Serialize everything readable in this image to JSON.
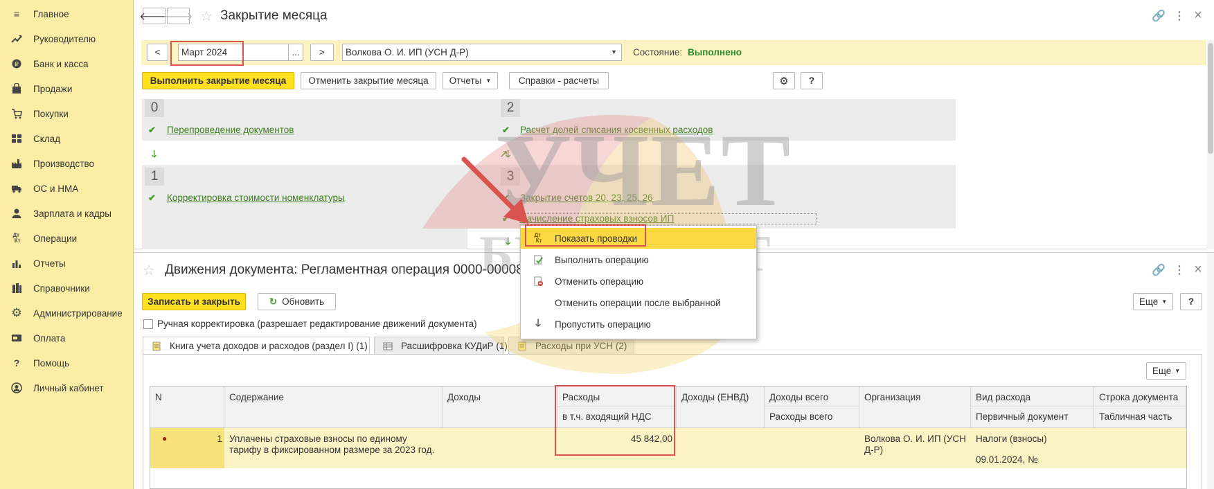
{
  "sidebar": {
    "items": [
      {
        "label": "Главное",
        "icon": "menu-icon"
      },
      {
        "label": "Руководителю",
        "icon": "trend-icon"
      },
      {
        "label": "Банк и касса",
        "icon": "coin-icon"
      },
      {
        "label": "Продажи",
        "icon": "bag-icon"
      },
      {
        "label": "Покупки",
        "icon": "cart-icon"
      },
      {
        "label": "Склад",
        "icon": "warehouse-icon"
      },
      {
        "label": "Производство",
        "icon": "factory-icon"
      },
      {
        "label": "ОС и НМА",
        "icon": "truck-icon"
      },
      {
        "label": "Зарплата и кадры",
        "icon": "person-icon"
      },
      {
        "label": "Операции",
        "icon": "dt-kt-icon"
      },
      {
        "label": "Отчеты",
        "icon": "bar-chart-icon"
      },
      {
        "label": "Справочники",
        "icon": "books-icon"
      },
      {
        "label": "Администрирование",
        "icon": "gear-icon"
      },
      {
        "label": "Оплата",
        "icon": "payment-icon"
      },
      {
        "label": "Помощь",
        "icon": "question-icon"
      },
      {
        "label": "Личный кабинет",
        "icon": "account-icon"
      }
    ]
  },
  "top_window": {
    "title": "Закрытие месяца",
    "period": "Март 2024",
    "period_select": "...",
    "prev": "<",
    "next": ">",
    "organization": "Волкова О. И. ИП (УСН Д-Р)",
    "state_label": "Состояние:",
    "state_value": "Выполнено",
    "buttons": {
      "run": "Выполнить закрытие месяца",
      "cancel": "Отменить закрытие месяца",
      "reports": "Отчеты",
      "refs": "Справки - расчеты",
      "help": "?"
    },
    "steps": [
      {
        "num": "0",
        "ops": [
          "Перепроведение документов"
        ]
      },
      {
        "num": "1",
        "ops": [
          "Корректировка стоимости номенклатуры"
        ]
      },
      {
        "num": "2",
        "ops": [
          "Расчет долей списания косвенных расходов"
        ]
      },
      {
        "num": "3",
        "ops": [
          "Закрытие счетов 20, 23, 25, 26",
          "Начисление страховых взносов ИП"
        ]
      }
    ]
  },
  "context_menu": {
    "items": [
      {
        "label": "Показать проводки",
        "icon": "dt-kt-icon",
        "selected": true
      },
      {
        "label": "Выполнить операцию",
        "icon": "run-op-icon",
        "selected": false
      },
      {
        "label": "Отменить операцию",
        "icon": "cancel-op-icon",
        "selected": false
      },
      {
        "label": "Отменить операции после выбранной",
        "icon": "",
        "selected": false
      },
      {
        "label": "Пропустить операцию",
        "icon": "arrow-down-icon",
        "selected": false
      }
    ]
  },
  "bottom_window": {
    "title": "Движения документа: Регламентная операция 0000-000082",
    "buttons": {
      "save_close": "Записать и закрыть",
      "refresh": "Обновить",
      "more": "Еще",
      "help": "?",
      "table_more": "Еще"
    },
    "manual_checkbox": "Ручная корректировка (разрешает редактирование движений документа)",
    "tabs": [
      "Книга учета доходов и расходов (раздел I) (1)",
      "Расшифровка КУДиР (1)",
      "Расходы при УСН (2)"
    ],
    "table": {
      "headers": {
        "n": "N",
        "content": "Содержание",
        "income": "Доходы",
        "expenses": "Расходы",
        "expenses_vat": "в т.ч. входящий НДС",
        "income_envd": "Доходы (ЕНВД)",
        "income_total": "Доходы всего",
        "expenses_total": "Расходы всего",
        "org": "Организация",
        "expense_type": "Вид расхода",
        "primary_doc": "Первичный документ",
        "doc_line": "Строка документа",
        "table_part": "Табличная часть"
      },
      "rows": [
        {
          "n": "1",
          "content_line1": "Уплачены страховые взносы по единому",
          "content_line2": "тарифу в фиксированном размере за 2023 год.",
          "expenses": "45 842,00",
          "org_line1": "Волкова О. И. ИП (УСН",
          "org_line2": "Д-Р)",
          "expense_type": "Налоги (взносы)",
          "primary_doc": "09.01.2024, №"
        }
      ]
    }
  },
  "watermark": {
    "line1": "УЧЕТ",
    "line2": "БЕЗ ЗАБОТ"
  },
  "colors": {
    "sidebar_bg": "#fbeda5",
    "accent_yellow": "#ffe11f",
    "link_green": "#3d7d1f",
    "highlight": "#d9534f"
  }
}
